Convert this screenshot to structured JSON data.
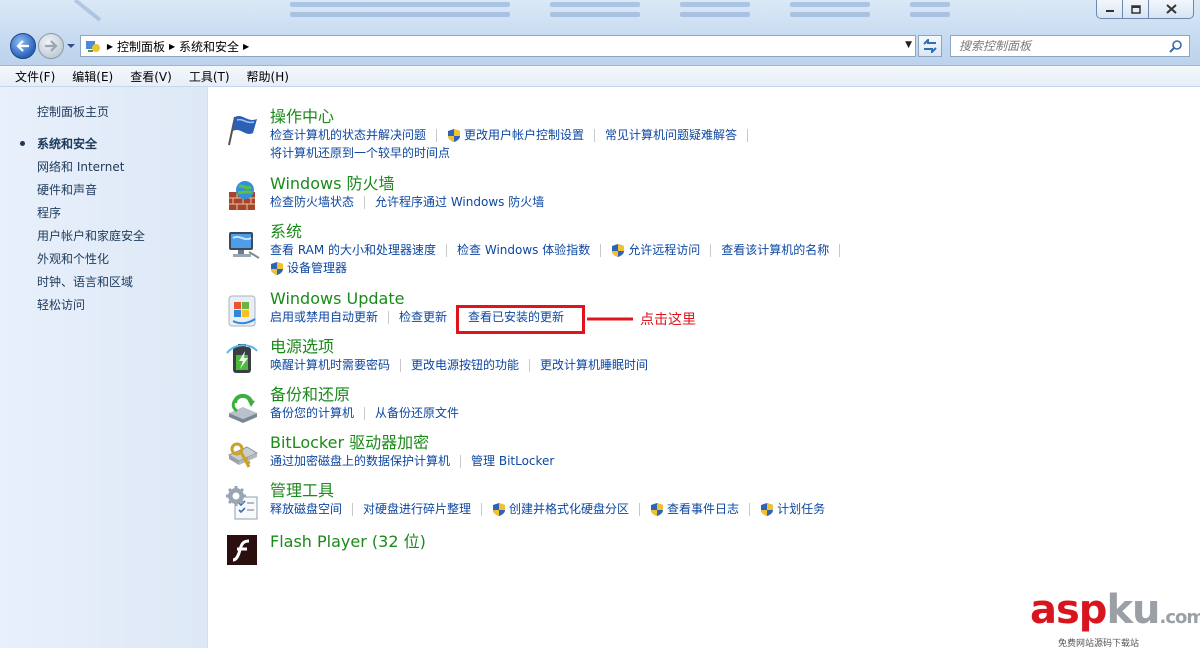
{
  "window": {
    "controls": {
      "minimize_icon": "minimize-icon",
      "maximize_icon": "maximize-icon",
      "close_icon": "close-icon"
    }
  },
  "nav": {
    "breadcrumbs": [
      "控制面板",
      "系统和安全"
    ],
    "search_placeholder": "搜索控制面板"
  },
  "menubar": [
    "文件(F)",
    "编辑(E)",
    "查看(V)",
    "工具(T)",
    "帮助(H)"
  ],
  "sidebar": {
    "home": "控制面板主页",
    "items": [
      {
        "label": "系统和安全",
        "active": true
      },
      {
        "label": "网络和 Internet"
      },
      {
        "label": "硬件和声音"
      },
      {
        "label": "程序"
      },
      {
        "label": "用户帐户和家庭安全"
      },
      {
        "label": "外观和个性化"
      },
      {
        "label": "时钟、语言和区域"
      },
      {
        "label": "轻松访问"
      }
    ]
  },
  "categories": {
    "action_center": {
      "title": "操作中心",
      "links": [
        "检查计算机的状态并解决问题",
        "更改用户帐户控制设置",
        "常见计算机问题疑难解答",
        "将计算机还原到一个较早的时间点"
      ]
    },
    "firewall": {
      "title": "Windows 防火墙",
      "links": [
        "检查防火墙状态",
        "允许程序通过 Windows 防火墙"
      ]
    },
    "system": {
      "title": "系统",
      "links": [
        "查看 RAM 的大小和处理器速度",
        "检查 Windows 体验指数",
        "允许远程访问",
        "查看该计算机的名称",
        "设备管理器"
      ]
    },
    "windows_update": {
      "title": "Windows Update",
      "links": [
        "启用或禁用自动更新",
        "检查更新",
        "查看已安装的更新"
      ]
    },
    "power": {
      "title": "电源选项",
      "links": [
        "唤醒计算机时需要密码",
        "更改电源按钮的功能",
        "更改计算机睡眠时间"
      ]
    },
    "backup": {
      "title": "备份和还原",
      "links": [
        "备份您的计算机",
        "从备份还原文件"
      ]
    },
    "bitlocker": {
      "title": "BitLocker 驱动器加密",
      "links": [
        "通过加密磁盘上的数据保护计算机",
        "管理 BitLocker"
      ]
    },
    "admin_tools": {
      "title": "管理工具",
      "links": [
        "释放磁盘空间",
        "对硬盘进行碎片整理",
        "创建并格式化硬盘分区",
        "查看事件日志",
        "计划任务"
      ]
    },
    "flash": {
      "title": "Flash Player (32 位)"
    }
  },
  "annotation": {
    "text": "点击这里",
    "color": "#e0141e"
  },
  "watermark": {
    "part1": "asp",
    "part2": "ku",
    "part3": ".com",
    "sub": "免费网站源码下载站"
  },
  "colors": {
    "link": "#0d47a1",
    "category_title": "#1a8a1a",
    "sidebar_bg": "#e3edf9"
  }
}
